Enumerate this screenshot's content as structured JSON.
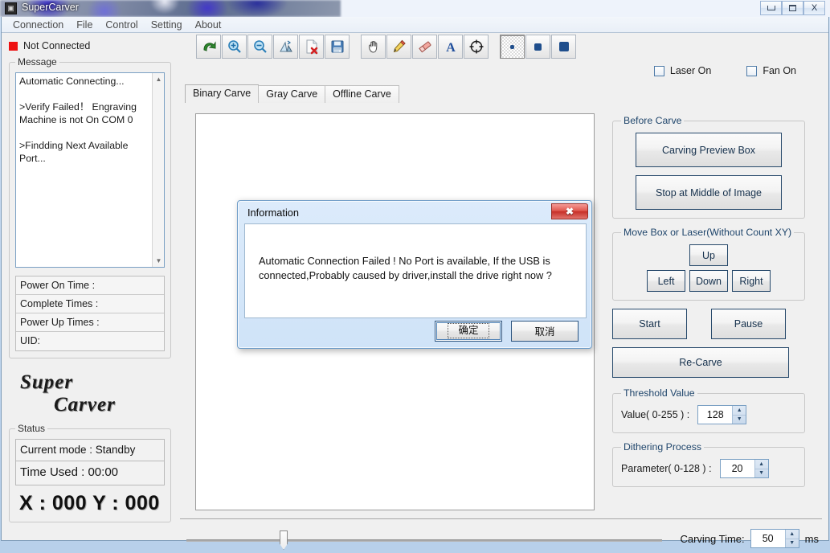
{
  "window": {
    "title": "SuperCarver",
    "icon": "app-icon",
    "minimize": "minimize-icon",
    "maximize": "maximize-icon",
    "close": "X"
  },
  "menu": [
    "Connection",
    "File",
    "Control",
    "Setting",
    "About"
  ],
  "left": {
    "connection_status": "Not Connected",
    "status_color": "#ee1111",
    "message_legend": "Message",
    "message_text": "Automatic Connecting...\n\n>Verify Failed！ Engraving Machine is not On COM 0\n\n>Findding Next Available Port...",
    "info_rows": [
      "Power On Time :",
      "Complete Times :",
      "Power Up Times :",
      "UID:"
    ],
    "brand_line1": "Super",
    "brand_line2": "Carver",
    "status_legend": "Status",
    "current_mode": "Current mode : Standby",
    "time_used": "Time Used :  00:00",
    "xy": "X : 000  Y : 000"
  },
  "toolbar": {
    "buttons": [
      {
        "name": "open-file-icon",
        "glyph": "↶"
      },
      {
        "name": "zoom-in-icon",
        "glyph": "⊕"
      },
      {
        "name": "zoom-out-icon",
        "glyph": "⊖"
      },
      {
        "name": "flip-image-icon",
        "glyph": "◢"
      },
      {
        "name": "delete-file-icon",
        "glyph": "✖"
      },
      {
        "name": "save-icon",
        "glyph": "Ὃe"
      },
      {
        "name": "pan-hand-icon",
        "glyph": "✋"
      },
      {
        "name": "pencil-icon",
        "glyph": "✎"
      },
      {
        "name": "eraser-icon",
        "glyph": "▭"
      },
      {
        "name": "text-tool-icon",
        "glyph": "A"
      },
      {
        "name": "target-icon",
        "glyph": "⌖"
      },
      {
        "name": "brush-small-icon",
        "glyph": ""
      },
      {
        "name": "brush-medium-icon",
        "glyph": ""
      },
      {
        "name": "brush-large-icon",
        "glyph": ""
      }
    ]
  },
  "checkboxes": [
    {
      "label": "Laser On",
      "checked": false
    },
    {
      "label": "Fan On",
      "checked": false
    }
  ],
  "tabs": [
    {
      "label": "Binary Carve",
      "active": true
    },
    {
      "label": "Gray Carve",
      "active": false
    },
    {
      "label": "Offline Carve",
      "active": false
    }
  ],
  "right": {
    "before_carve_legend": "Before Carve",
    "carving_preview_box": "Carving Preview Box",
    "stop_at_middle": "Stop at Middle of Image",
    "move_legend": "Move Box or Laser(Without Count XY)",
    "up": "Up",
    "left": "Left",
    "down": "Down",
    "right": "Right",
    "start": "Start",
    "pause": "Pause",
    "recarve": "Re-Carve",
    "threshold_legend": "Threshold Value",
    "threshold_label": "Value( 0-255 ) :",
    "threshold_value": "128",
    "dither_legend": "Dithering Process",
    "dither_label": "Parameter( 0-128 ) :",
    "dither_value": "20"
  },
  "bottom": {
    "carving_time_label": "Carving Time:",
    "carving_time_value": "50",
    "unit": "ms",
    "slider_position_percent": 20
  },
  "dialog": {
    "title": "Information",
    "close_glyph": "✖",
    "message": "Automatic Connection Failed ! No Port is available, If the USB is connected,Probably caused by driver,install the drive right now ?",
    "ok_label": "确定",
    "cancel_label": "取消"
  }
}
